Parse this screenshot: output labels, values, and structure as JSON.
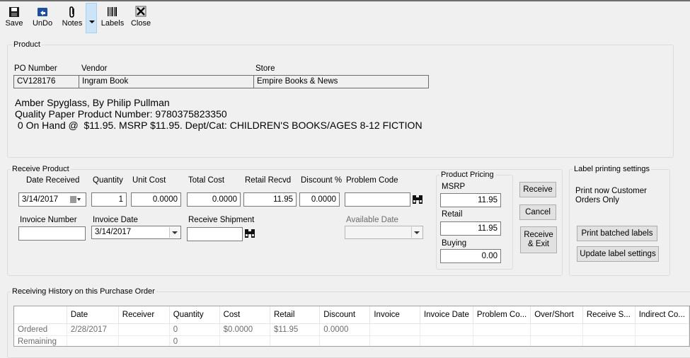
{
  "toolbar": {
    "save": "Save",
    "undo": "UnDo",
    "notes": "Notes",
    "labels": "Labels",
    "close": "Close"
  },
  "product": {
    "legend": "Product",
    "po_label": "PO Number",
    "po_value": "CV128176",
    "vendor_label": "Vendor",
    "vendor_value": "Ingram Book",
    "store_label": "Store",
    "store_value": "Empire Books & News",
    "line1": "Amber Spyglass, By Philip Pullman",
    "line2": "Quality Paper Product Number: 9780375823350",
    "line3": " 0 On Hand @  $11.95. MSRP $11.95. Dept/Cat: CHILDREN'S BOOKS/AGES 8-12 FICTION"
  },
  "receive": {
    "legend": "Receive Product",
    "date_received_label": "Date Received",
    "date_received_value": "3/14/2017",
    "quantity_label": "Quantity",
    "quantity_value": "1",
    "unit_cost_label": "Unit Cost",
    "unit_cost_value": "0.0000",
    "total_cost_label": "Total Cost",
    "total_cost_value": "0.0000",
    "retail_recvd_label": "Retail Recvd",
    "retail_recvd_value": "11.95",
    "discount_label": "Discount %",
    "discount_value": "0.0000",
    "problem_code_label": "Problem Code",
    "problem_code_value": "",
    "invoice_number_label": "Invoice Number",
    "invoice_number_value": "",
    "invoice_date_label": "Invoice Date",
    "invoice_date_value": "3/14/2017",
    "receive_shipment_label": "Receive Shipment",
    "receive_shipment_value": "",
    "available_date_label": "Available Date",
    "available_date_value": ""
  },
  "pricing": {
    "legend": "Product Pricing",
    "msrp_label": "MSRP",
    "msrp_value": "11.95",
    "retail_label": "Retail",
    "retail_value": "11.95",
    "buying_label": "Buying",
    "buying_value": "0.00"
  },
  "actions": {
    "receive": "Receive",
    "cancel": "Cancel",
    "receive_exit_1": "Receive",
    "receive_exit_2": "& Exit"
  },
  "label_settings": {
    "legend": "Label printing settings",
    "text1": "Print now Customer",
    "text2": "Orders Only",
    "print_batched": "Print batched labels",
    "update_settings": "Update label settings"
  },
  "history": {
    "legend": "Receiving History on this Purchase Order",
    "columns": [
      "",
      "Date",
      "Receiver",
      "Quantity",
      "Cost",
      "Retail",
      "Discount",
      "Invoice",
      "Invoice Date",
      "Problem Co...",
      "Over/Short",
      "Receive S...",
      "Indirect Co..."
    ],
    "rows": [
      [
        "Ordered",
        "2/28/2017",
        "",
        "0",
        "$0.0000",
        "$11.95",
        "0.0000",
        "",
        "",
        "",
        "",
        "",
        ""
      ],
      [
        "Remaining",
        "",
        "",
        "0",
        "",
        "",
        "",
        "",
        "",
        "",
        "",
        "",
        ""
      ]
    ]
  }
}
